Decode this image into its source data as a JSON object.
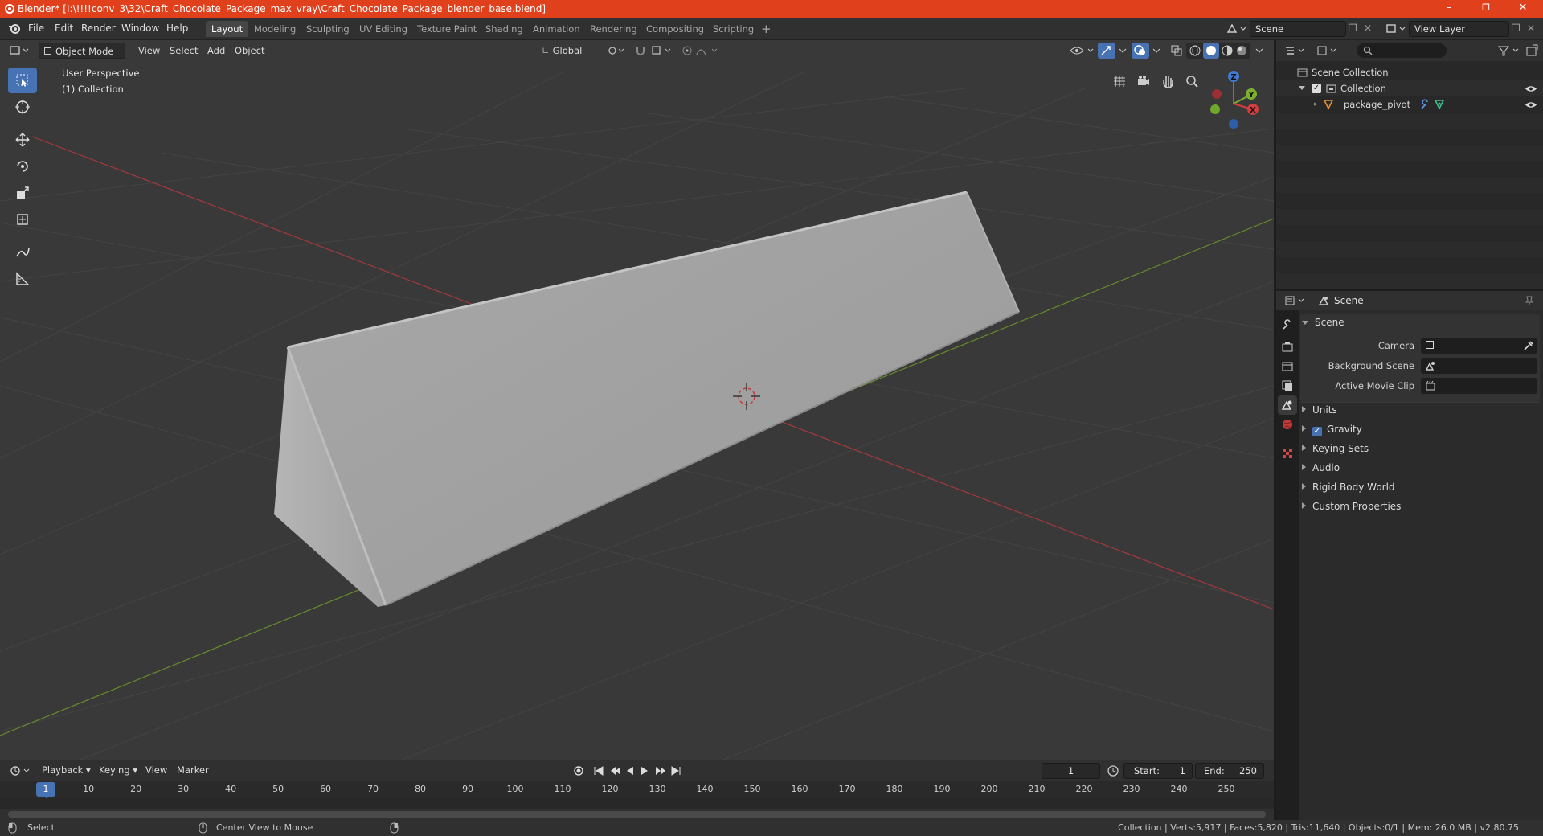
{
  "window": {
    "title": "Blender* [I:\\!!!!conv_3\\32\\Craft_Chocolate_Package_max_vray\\Craft_Chocolate_Package_blender_base.blend]",
    "minimize": "–",
    "restore": "❐",
    "close": "✕"
  },
  "menu": [
    "File",
    "Edit",
    "Render",
    "Window",
    "Help"
  ],
  "workspaces": [
    "Layout",
    "Modeling",
    "Sculpting",
    "UV Editing",
    "Texture Paint",
    "Shading",
    "Animation",
    "Rendering",
    "Compositing",
    "Scripting"
  ],
  "active_workspace": "Layout",
  "add_workspace": "+",
  "scene_field": "Scene",
  "view_layer_field": "View Layer",
  "viewport": {
    "mode": "Object Mode",
    "menus": [
      "View",
      "Select",
      "Add",
      "Object"
    ],
    "transform_orientation": "Global",
    "overlay_line1": "User Perspective",
    "overlay_line2": "(1) Collection",
    "gizmo": {
      "z": "Z",
      "y": "Y",
      "x": "X"
    }
  },
  "outliner": {
    "root": "Scene Collection",
    "collection": "Collection",
    "object": "package_pivot"
  },
  "properties": {
    "header": "Scene",
    "panel_scene": "Scene",
    "camera_label": "Camera",
    "background_scene_label": "Background Scene",
    "active_movie_clip_label": "Active Movie Clip",
    "panels": [
      "Units",
      "Gravity",
      "Keying Sets",
      "Audio",
      "Rigid Body World",
      "Custom Properties"
    ]
  },
  "timeline": {
    "menus": [
      "Playback",
      "Keying",
      "View",
      "Marker"
    ],
    "current_frame": "1",
    "start_label": "Start:",
    "start_value": "1",
    "end_label": "End:",
    "end_value": "250",
    "ruler": [
      "1",
      "10",
      "20",
      "30",
      "40",
      "50",
      "60",
      "70",
      "80",
      "90",
      "100",
      "110",
      "120",
      "130",
      "140",
      "150",
      "160",
      "170",
      "180",
      "190",
      "200",
      "210",
      "220",
      "230",
      "240",
      "250"
    ]
  },
  "status": {
    "select": "Select",
    "center_view": "Center View to Mouse",
    "stats": "Collection | Verts:5,917 | Faces:5,820 | Tris:11,640 | Objects:0/1 | Mem: 26.0 MB | v2.80.75"
  },
  "colors": {
    "title_bar": "#e0401b",
    "accent_blue": "#4772b3",
    "viewport_bg": "#393939",
    "x_axis": "#d03a3a",
    "y_axis": "#76a22a"
  }
}
